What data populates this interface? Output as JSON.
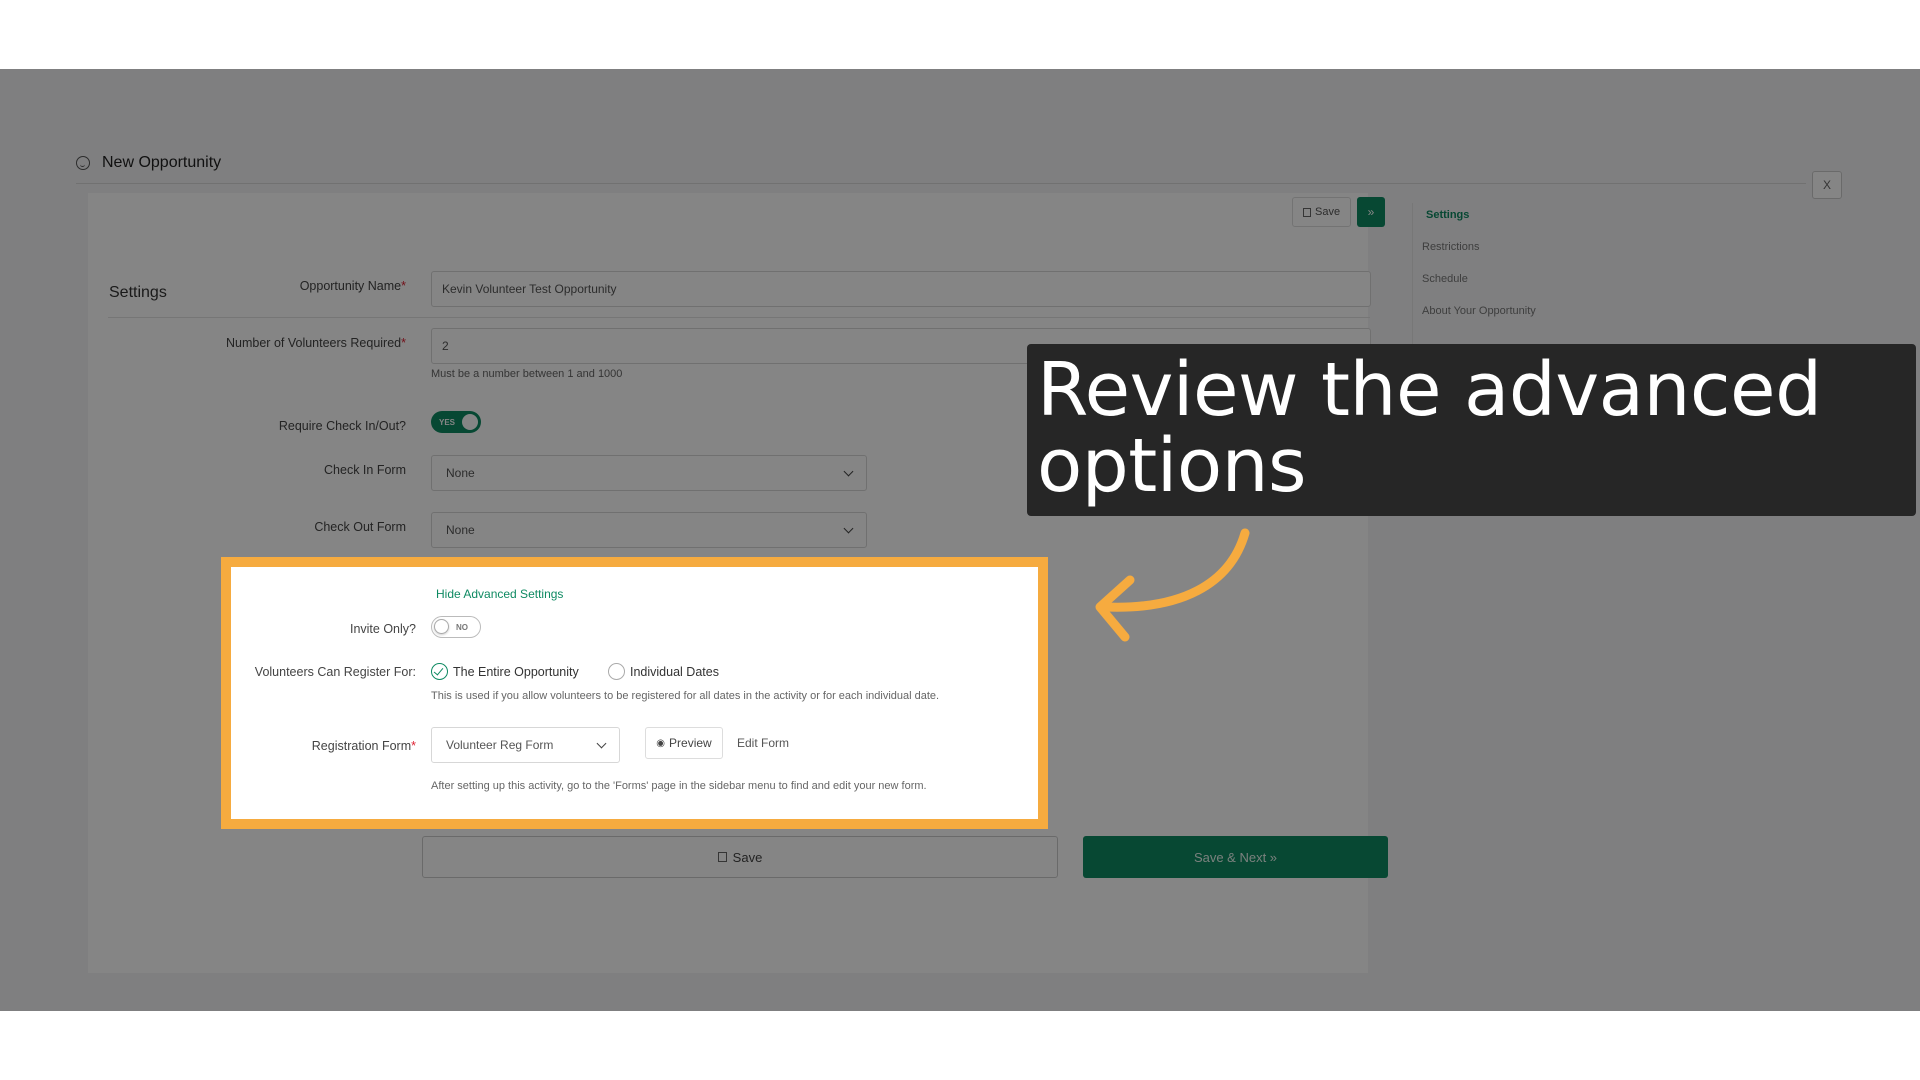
{
  "header": {
    "title": "New Opportunity",
    "close_label": "X"
  },
  "card": {
    "section_title": "Settings",
    "save_label": "Save",
    "next_label": "»"
  },
  "side_nav": {
    "items": [
      {
        "label": "Settings"
      },
      {
        "label": "Restrictions"
      },
      {
        "label": "Schedule"
      },
      {
        "label": "About Your Opportunity"
      }
    ]
  },
  "form": {
    "opportunity_name": {
      "label": "Opportunity Name",
      "value": "Kevin Volunteer Test Opportunity"
    },
    "volunteers_required": {
      "label": "Number of Volunteers Required",
      "value": "2",
      "help": "Must be a number between 1 and 1000"
    },
    "require_check": {
      "label": "Require Check In/Out?",
      "state": "YES"
    },
    "check_in_form": {
      "label": "Check In Form",
      "value": "None"
    },
    "check_out_form": {
      "label": "Check Out Form",
      "value": "None"
    },
    "required_mark": "*"
  },
  "advanced": {
    "toggle_link": "Hide Advanced Settings",
    "invite_only": {
      "label": "Invite Only?",
      "state": "NO"
    },
    "register_for": {
      "label": "Volunteers Can Register For:",
      "options": [
        "The Entire Opportunity",
        "Individual Dates"
      ],
      "selected": "The Entire Opportunity",
      "help": "This is used if you allow volunteers to be registered for all dates in the activity or for each individual date."
    },
    "registration_form": {
      "label": "Registration Form",
      "value": "Volunteer Reg Form",
      "preview_label": "Preview",
      "edit_label": "Edit Form",
      "help": "After setting up this activity, go to the 'Forms' page in the sidebar menu to find and edit your new form."
    }
  },
  "footer": {
    "save_label": "Save",
    "save_next_label": "Save & Next »"
  },
  "callout": {
    "text": "Review the advanced options"
  },
  "widgets": {
    "a11y_count": "13"
  },
  "colors": {
    "accent": "#0e8a62",
    "highlight": "#f6ab3f",
    "callout_bg": "#262626"
  }
}
